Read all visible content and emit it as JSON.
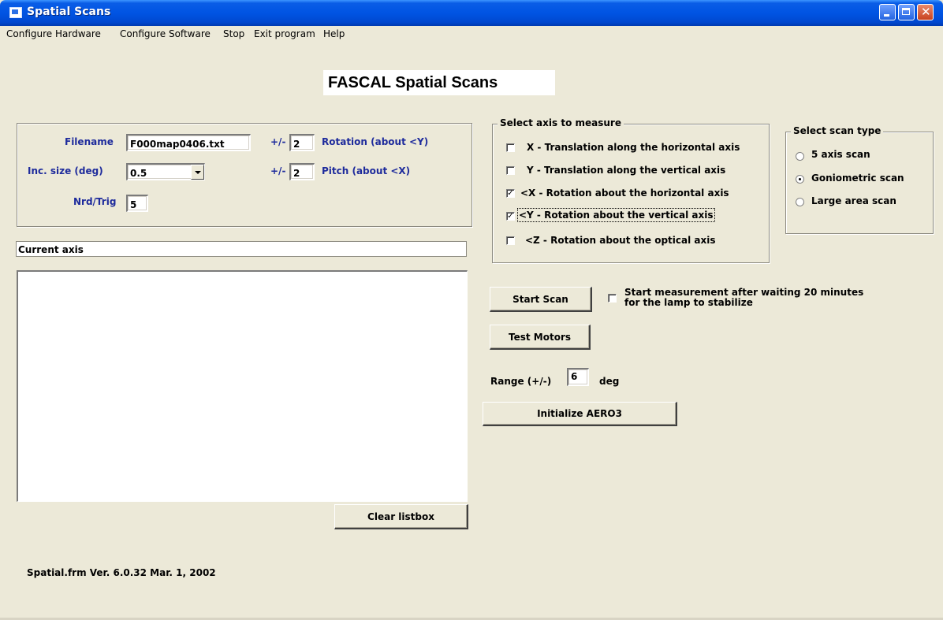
{
  "window": {
    "title": "Spatial Scans"
  },
  "menu": [
    "Configure Hardware",
    "Configure Software",
    "Stop",
    "Exit program",
    "Help"
  ],
  "heading": "FASCAL Spatial Scans",
  "params": {
    "filename_label": "Filename",
    "filename_value": "F000map0406.txt",
    "inc_label": "Inc. size (deg)",
    "inc_value": "0.5",
    "nrd_label": "Nrd/Trig",
    "nrd_value": "5",
    "pm1_label": "+/-",
    "pm1_value": "2",
    "rotation_label": "Rotation (about <Y)",
    "pm2_label": "+/-",
    "pm2_value": "2",
    "pitch_label": "Pitch (about <X)"
  },
  "current_axis": "Current axis",
  "clear_listbox": "Clear listbox",
  "version": "Spatial.frm  Ver. 6.0.32  Mar. 1, 2002",
  "axis_group": {
    "title": "Select axis to measure",
    "items": [
      {
        "label": "X - Translation along the horizontal axis",
        "checked": false
      },
      {
        "label": "Y - Translation along the vertical axis",
        "checked": false
      },
      {
        "label": "<X - Rotation about the horizontal axis",
        "checked": true
      },
      {
        "label": "<Y - Rotation about the vertical axis",
        "checked": true
      },
      {
        "label": "<Z - Rotation about the optical axis",
        "checked": false
      }
    ]
  },
  "scan_type": {
    "title": "Select scan type",
    "options": [
      {
        "label": "5 axis scan",
        "selected": false
      },
      {
        "label": "Goniometric scan",
        "selected": true
      },
      {
        "label": "Large area scan",
        "selected": false
      }
    ]
  },
  "start_scan": "Start Scan",
  "wait_text_1": "Start measurement after waiting 20 minutes",
  "wait_text_2": "for the lamp to stabilize",
  "wait_checked": false,
  "test_motors": "Test Motors",
  "range_label": "Range (+/-)",
  "range_value": "6",
  "range_unit": "deg",
  "initialize": "Initialize AERO3"
}
